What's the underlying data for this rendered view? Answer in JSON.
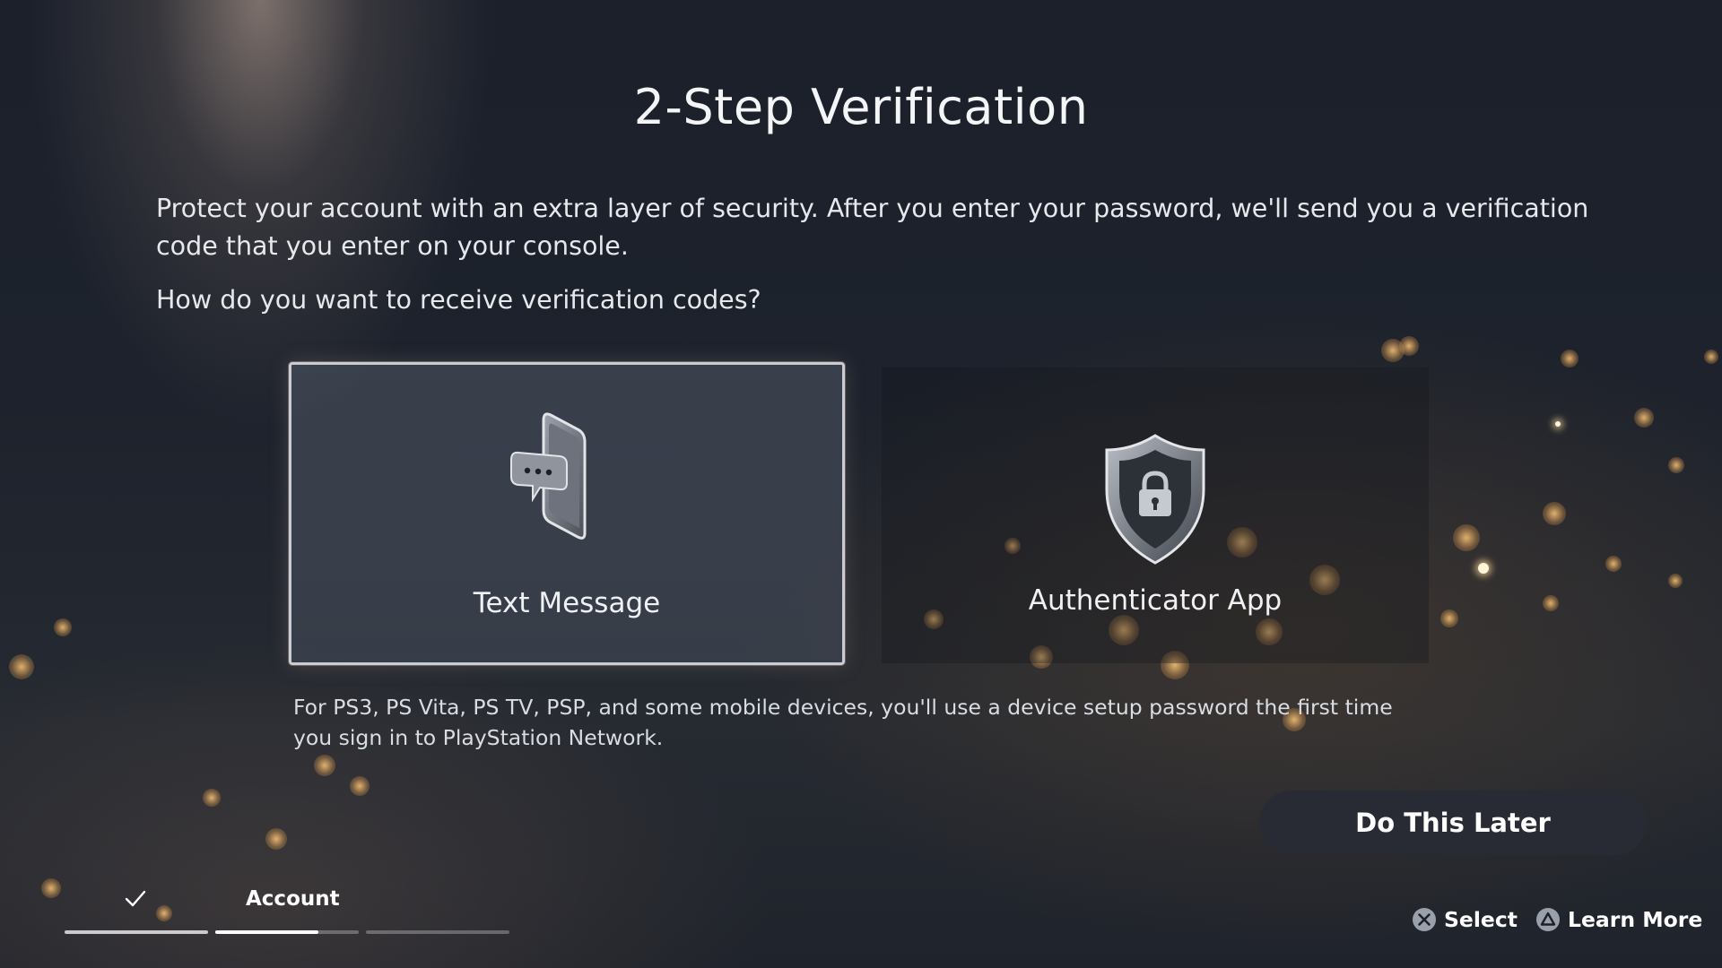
{
  "screen": {
    "title": "2-Step Verification",
    "description": "Protect your account with an extra layer of security. After you enter your password, we'll send you a verification code that you enter on your console.",
    "question": "How do you want to receive verification codes?"
  },
  "options": [
    {
      "label": "Text Message",
      "icon": "phone-message-icon",
      "selected": true
    },
    {
      "label": "Authenticator App",
      "icon": "shield-lock-icon",
      "selected": false
    }
  ],
  "footnote": "For PS3, PS Vita, PS TV, PSP, and some mobile devices, you'll use a device setup password the first time you sign in to PlayStation Network.",
  "actions": {
    "do_later_label": "Do This Later"
  },
  "progress": {
    "current_step_label": "Account",
    "completed_icon": "checkmark-icon",
    "steps_total": 3,
    "current_step": 2,
    "current_step_fill": 0.72
  },
  "controller_hints": [
    {
      "glyph": "cross-button-icon",
      "label": "Select"
    },
    {
      "glyph": "triangle-button-icon",
      "label": "Learn More"
    }
  ],
  "colors": {
    "background": "#1d222c",
    "card_border": "#c9ccd3",
    "button_bg": "#282b34",
    "text": "#f4f5f7"
  }
}
